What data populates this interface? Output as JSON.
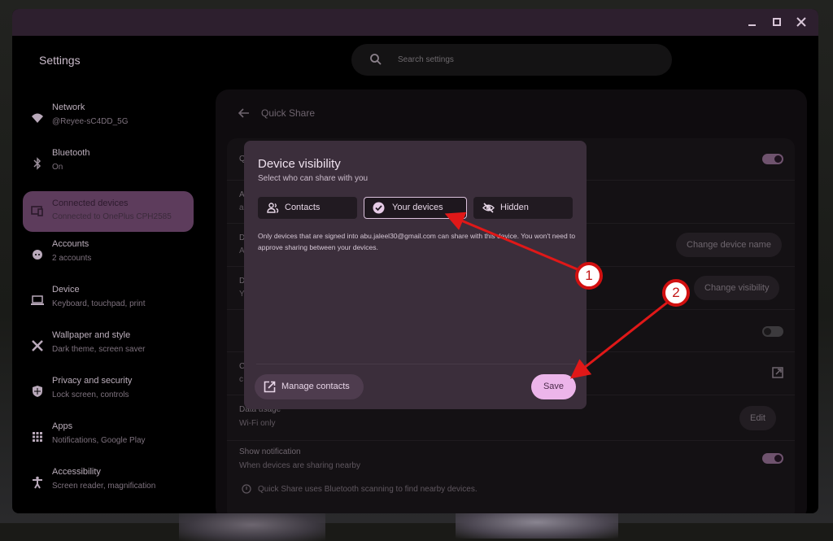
{
  "window": {
    "app_title": "Settings",
    "controls": {
      "minimize": "minimize",
      "maximize": "maximize",
      "close": "close"
    }
  },
  "search": {
    "placeholder": "Search settings",
    "value": ""
  },
  "sidebar": {
    "items": [
      {
        "title": "Network",
        "subtitle": "@Reyee-sC4DD_5G",
        "icon": "wifi-icon",
        "active": false
      },
      {
        "title": "Bluetooth",
        "subtitle": "On",
        "icon": "bluetooth-icon",
        "active": false
      },
      {
        "title": "Connected devices",
        "subtitle": "Connected to OnePlus CPH2585",
        "icon": "connected-devices-icon",
        "active": true
      },
      {
        "title": "Accounts",
        "subtitle": "2 accounts",
        "icon": "accounts-icon",
        "active": false
      },
      {
        "title": "Device",
        "subtitle": "Keyboard, touchpad, print",
        "icon": "laptop-icon",
        "active": false
      },
      {
        "title": "Wallpaper and style",
        "subtitle": "Dark theme, screen saver",
        "icon": "palette-icon",
        "active": false
      },
      {
        "title": "Privacy and security",
        "subtitle": "Lock screen, controls",
        "icon": "shield-icon",
        "active": false
      },
      {
        "title": "Apps",
        "subtitle": "Notifications, Google Play",
        "icon": "apps-grid-icon",
        "active": false
      },
      {
        "title": "Accessibility",
        "subtitle": "Screen reader, magnification",
        "icon": "accessibility-icon",
        "active": false
      }
    ]
  },
  "page": {
    "title": "Quick Share",
    "rows": {
      "quick_share": {
        "title": "Q",
        "toggle": true
      },
      "account": {
        "title": "A",
        "subtitle": "a"
      },
      "device_name": {
        "title": "D",
        "subtitle": "A",
        "button": "Change device name"
      },
      "device_visibility": {
        "title": "D",
        "subtitle": "Y",
        "button": "Change visibility"
      },
      "hidden_toggle": {
        "toggle": false
      },
      "contacts": {
        "title": "C",
        "subtitle": "c"
      },
      "data_usage": {
        "title": "Data usage",
        "subtitle": "Wi-Fi only",
        "button": "Edit"
      },
      "show_notification": {
        "title": "Show notification",
        "subtitle": "When devices are sharing nearby",
        "toggle": true
      }
    },
    "info": "Quick Share uses Bluetooth scanning to find nearby devices."
  },
  "dialog": {
    "title": "Device visibility",
    "subtitle": "Select who can share with you",
    "options": [
      {
        "label": "Contacts",
        "icon": "contacts-icon",
        "selected": false
      },
      {
        "label": "Your devices",
        "icon": "check-circle-icon",
        "selected": true
      },
      {
        "label": "Hidden",
        "icon": "eye-off-icon",
        "selected": false
      }
    ],
    "description": "Only devices that are signed into abu.jaleel30@gmail.com can share with this device. You won't need to approve sharing between your devices.",
    "manage_contacts": "Manage contacts",
    "save": "Save"
  },
  "annotations": [
    {
      "number": "1",
      "color": "#d11010",
      "target": "Your devices"
    },
    {
      "number": "2",
      "color": "#d11010",
      "target": "Save"
    }
  ]
}
